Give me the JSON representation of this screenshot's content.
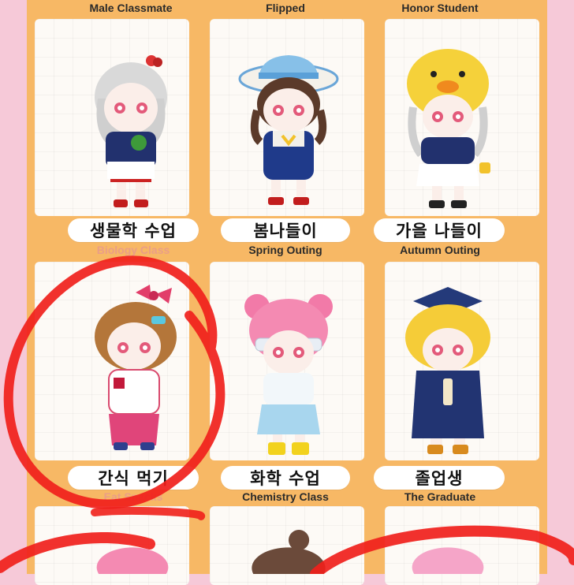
{
  "top_row": [
    {
      "name": "Male Classmate"
    },
    {
      "name": "Flipped"
    },
    {
      "name": "Honor Student"
    }
  ],
  "grid": [
    {
      "ko": "생물학 수업",
      "en": "Biology Class",
      "figure": "silver-hair-girl-in-navy-sweater"
    },
    {
      "ko": "봄나들이",
      "en": "Spring Outing",
      "figure": "girl-with-blue-sun-hat"
    },
    {
      "ko": "가을 나들이",
      "en": "Autumn Outing",
      "figure": "girl-with-yellow-chick-hat"
    },
    {
      "ko": "간식 먹기",
      "en": "Eat Snacks",
      "figure": "girl-with-pink-bow-tracksuit"
    },
    {
      "ko": "화학 수업",
      "en": "Chemistry Class",
      "figure": "pink-bun-hair-girl-with-goggles"
    },
    {
      "ko": "졸업생",
      "en": "The Graduate",
      "figure": "blonde-girl-in-graduation-cap"
    }
  ],
  "colors": {
    "frame": "#f7b865",
    "background": "#f6c9d8",
    "card": "#fdfaf6",
    "marker": "#f0201b"
  }
}
